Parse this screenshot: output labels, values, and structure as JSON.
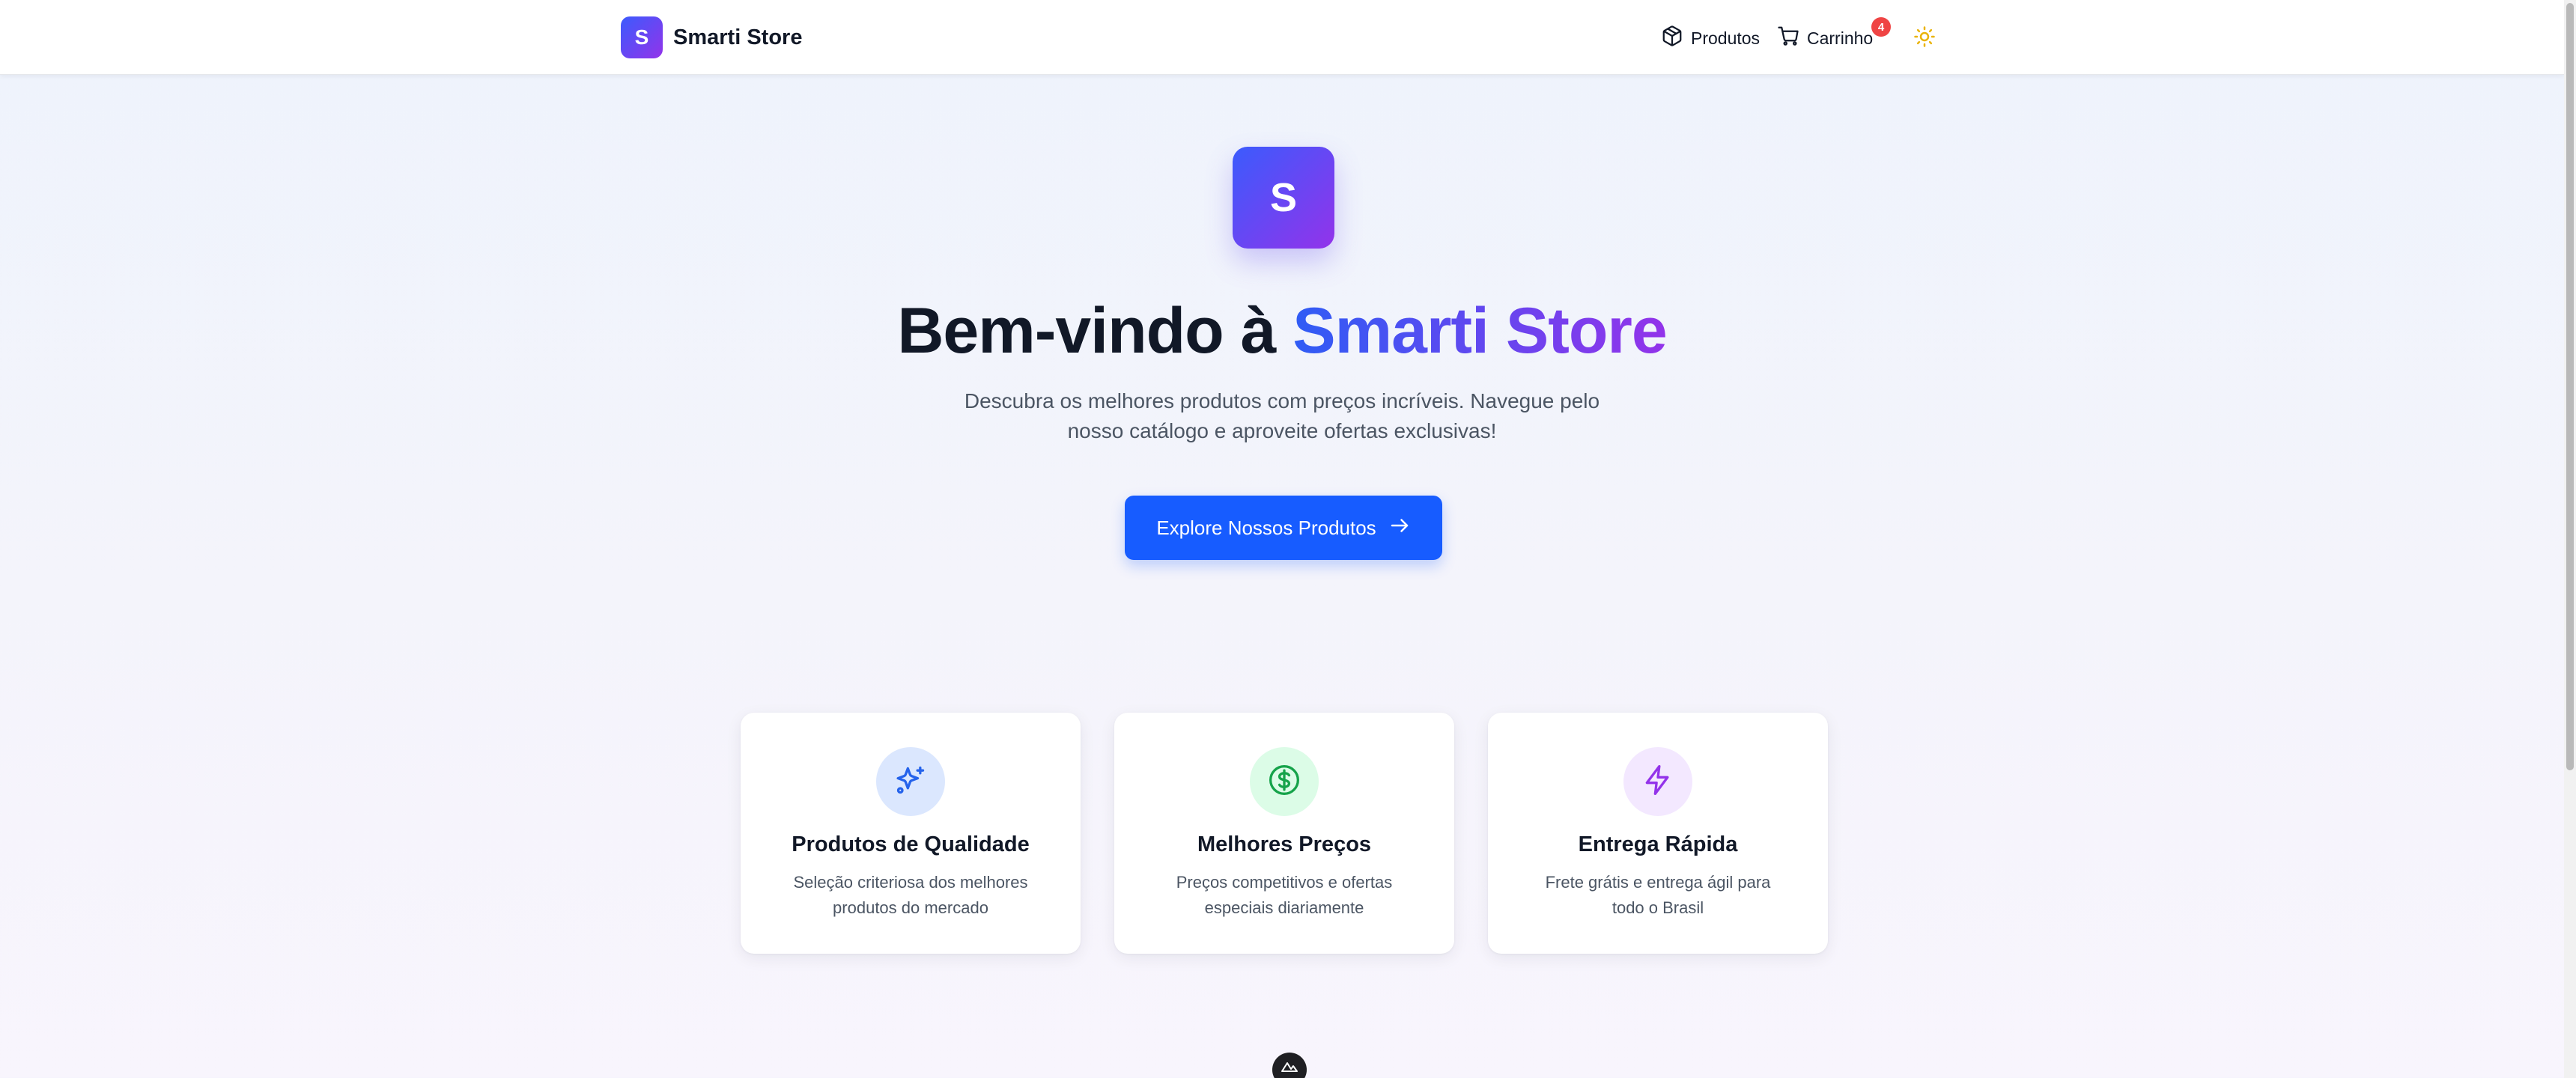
{
  "header": {
    "brand_letter": "S",
    "brand_name": "Smarti Store",
    "nav_products": "Produtos",
    "nav_cart": "Carrinho",
    "cart_count": "4"
  },
  "hero": {
    "logo_letter": "S",
    "title_prefix": "Bem-vindo à ",
    "title_accent": "Smarti Store",
    "subtitle": "Descubra os melhores produtos com preços incríveis. Navegue pelo nosso catálogo e aproveite ofertas exclusivas!",
    "cta_label": "Explore Nossos Produtos"
  },
  "features": [
    {
      "icon": "sparkles-icon",
      "title": "Produtos de Qualidade",
      "description": "Seleção criteriosa dos melhores produtos do mercado"
    },
    {
      "icon": "dollar-icon",
      "title": "Melhores Preços",
      "description": "Preços competitivos e ofertas especiais diariamente"
    },
    {
      "icon": "lightning-icon",
      "title": "Entrega Rápida",
      "description": "Frete grátis e entrega ágil para todo o Brasil"
    }
  ],
  "colors": {
    "primary": "#175cff",
    "gradient_start": "#3b5bfd",
    "gradient_end": "#9333ea",
    "badge": "#ef4444",
    "theme_icon": "#eab308"
  }
}
